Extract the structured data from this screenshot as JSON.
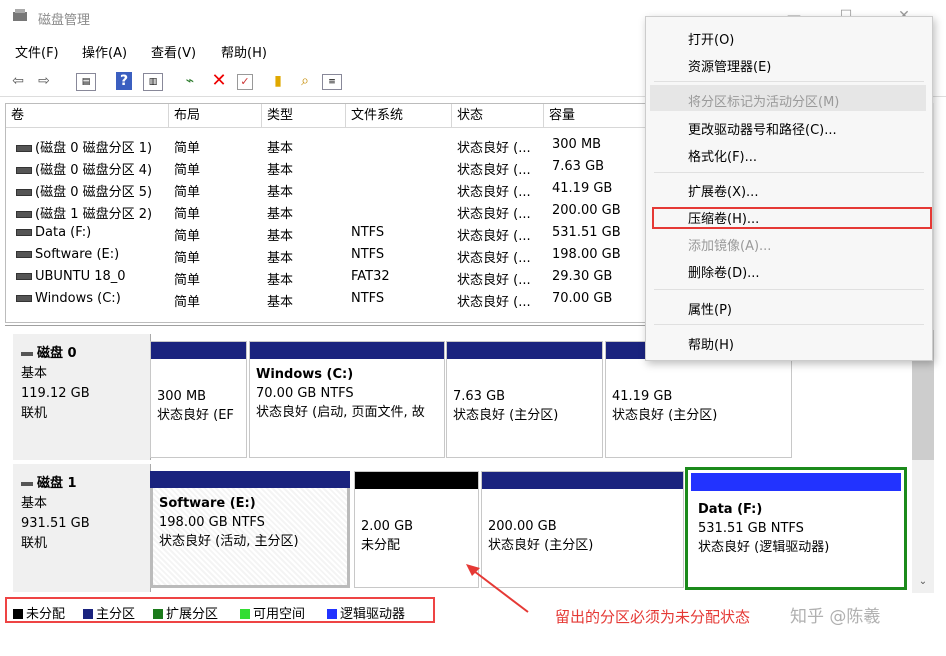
{
  "window": {
    "title": "磁盘管理",
    "min": "—",
    "max": "☐",
    "close": "✕"
  },
  "menu": [
    "文件(F)",
    "操作(A)",
    "查看(V)",
    "帮助(H)"
  ],
  "list": {
    "headers": [
      "卷",
      "布局",
      "类型",
      "文件系统",
      "状态",
      "容量"
    ],
    "rows": [
      [
        "(磁盘 0 磁盘分区 1)",
        "简单",
        "基本",
        "",
        "状态良好 (...",
        "300 MB"
      ],
      [
        "(磁盘 0 磁盘分区 4)",
        "简单",
        "基本",
        "",
        "状态良好 (...",
        "7.63 GB"
      ],
      [
        "(磁盘 0 磁盘分区 5)",
        "简单",
        "基本",
        "",
        "状态良好 (...",
        "41.19 GB"
      ],
      [
        "(磁盘 1 磁盘分区 2)",
        "简单",
        "基本",
        "",
        "状态良好 (...",
        "200.00 GB"
      ],
      [
        "Data (F:)",
        "简单",
        "基本",
        "NTFS",
        "状态良好 (...",
        "531.51 GB"
      ],
      [
        "Software (E:)",
        "简单",
        "基本",
        "NTFS",
        "状态良好 (...",
        "198.00 GB"
      ],
      [
        "UBUNTU 18_0",
        "简单",
        "基本",
        "FAT32",
        "状态良好 (...",
        "29.30 GB"
      ],
      [
        "Windows (C:)",
        "简单",
        "基本",
        "NTFS",
        "状态良好 (...",
        "70.00 GB"
      ]
    ]
  },
  "disks": [
    {
      "name": "磁盘 0",
      "type": "基本",
      "size": "119.12 GB",
      "status": "联机",
      "partitions": [
        {
          "title": "",
          "size": "300 MB",
          "status": "状态良好 (EF"
        },
        {
          "title": "Windows (C:)",
          "size": "70.00 GB NTFS",
          "status": "状态良好 (启动, 页面文件, 故"
        },
        {
          "title": "",
          "size": "7.63 GB",
          "status": "状态良好 (主分区)"
        },
        {
          "title": "",
          "size": "41.19 GB",
          "status": "状态良好 (主分区)"
        }
      ]
    },
    {
      "name": "磁盘 1",
      "type": "基本",
      "size": "931.51 GB",
      "status": "联机",
      "partitions": [
        {
          "title": "Software (E:)",
          "size": "198.00 GB NTFS",
          "status": "状态良好 (活动, 主分区)"
        },
        {
          "title": "",
          "size": "2.00 GB",
          "status": "未分配"
        },
        {
          "title": "",
          "size": "200.00 GB",
          "status": "状态良好 (主分区)"
        },
        {
          "title": "Data (F:)",
          "size": "531.51 GB NTFS",
          "status": "状态良好 (逻辑驱动器)"
        }
      ]
    }
  ],
  "legend": [
    {
      "label": "未分配",
      "color": "#000000"
    },
    {
      "label": "主分区",
      "color": "#1a237e"
    },
    {
      "label": "扩展分区",
      "color": "#1b7a1b"
    },
    {
      "label": "可用空间",
      "color": "#33dd33"
    },
    {
      "label": "逻辑驱动器",
      "color": "#2233ff"
    }
  ],
  "context_menu": [
    {
      "label": "打开(O)",
      "enabled": true
    },
    {
      "label": "资源管理器(E)",
      "enabled": true
    },
    {
      "label": "将分区标记为活动分区(M)",
      "enabled": false
    },
    {
      "label": "更改驱动器号和路径(C)...",
      "enabled": true
    },
    {
      "label": "格式化(F)...",
      "enabled": true
    },
    {
      "label": "扩展卷(X)...",
      "enabled": true
    },
    {
      "label": "压缩卷(H)...",
      "enabled": true
    },
    {
      "label": "添加镜像(A)...",
      "enabled": false
    },
    {
      "label": "删除卷(D)...",
      "enabled": true
    },
    {
      "label": "属性(P)",
      "enabled": true
    },
    {
      "label": "帮助(H)",
      "enabled": true
    }
  ],
  "annotation": "留出的分区必须为未分配状态",
  "watermark": "知乎 @陈羲",
  "colors": {
    "primary_bar": "#1a237e",
    "logical_bar": "#2233ff",
    "unallocated_bar": "#000000",
    "highlight": "#e53935",
    "selected_border": "#1b8a1b"
  }
}
